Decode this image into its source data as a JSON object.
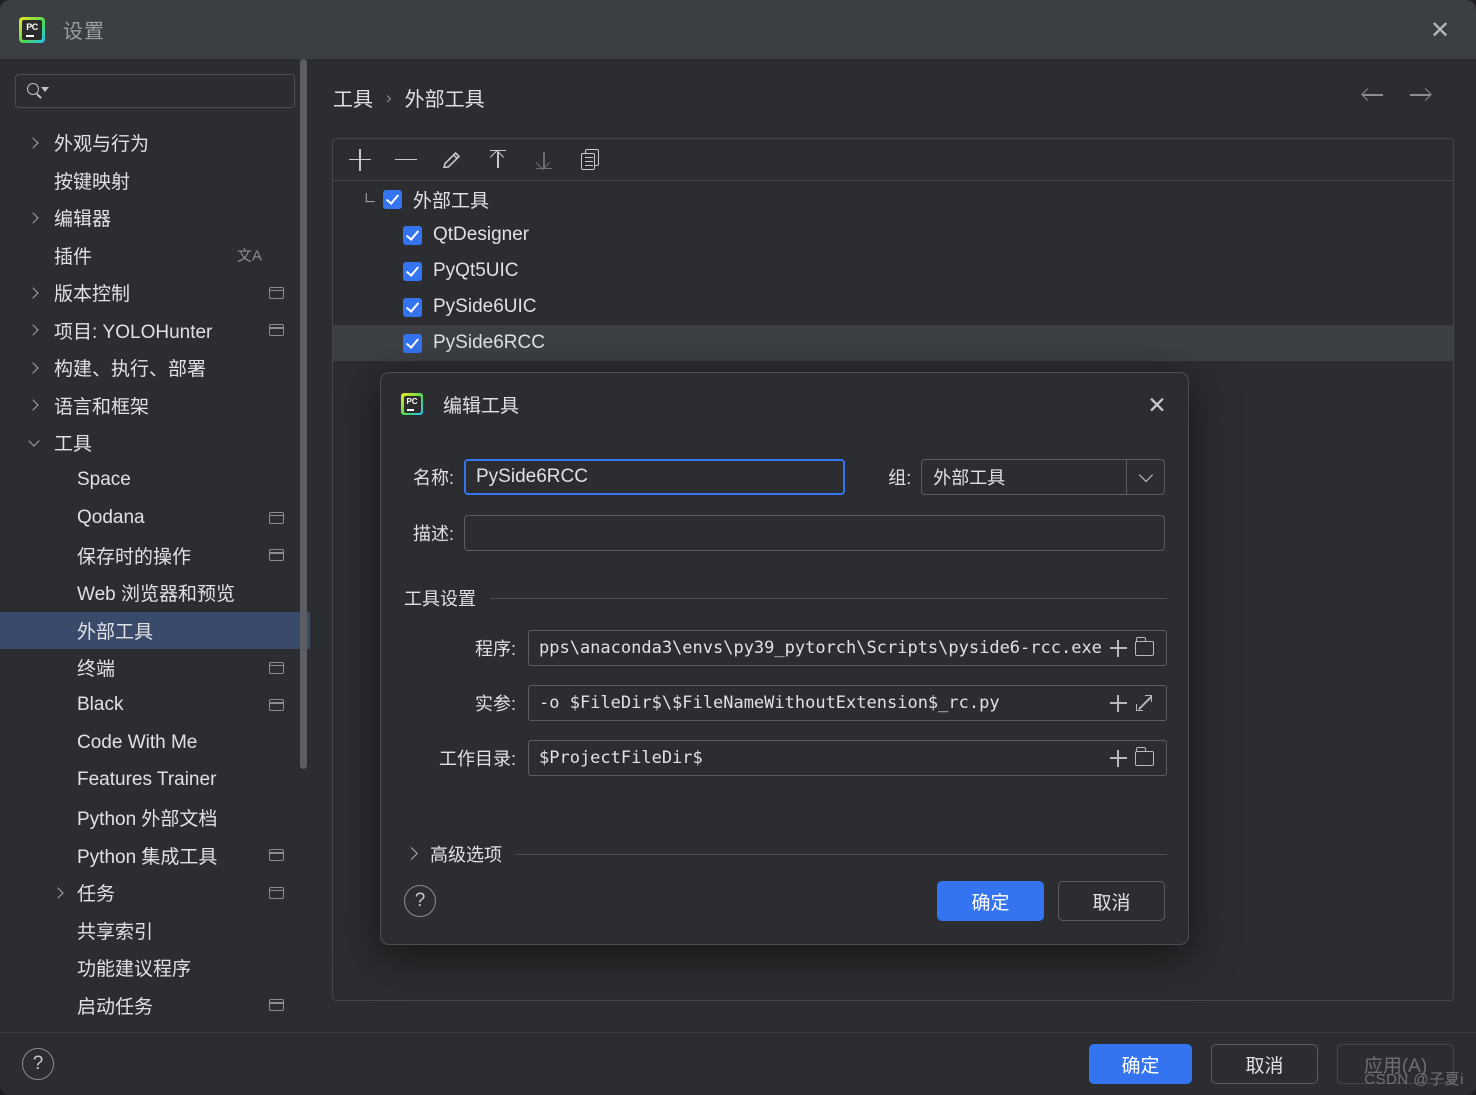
{
  "window": {
    "title": "设置",
    "app_icon": "pycharm-icon",
    "close_icon": "close-icon",
    "watermark": "CSDN @子夏i"
  },
  "sidebar": {
    "search": {
      "placeholder": "",
      "value": "",
      "icon": "search-icon"
    },
    "items": [
      {
        "label": "外观与行为",
        "arrow": "chevron-right",
        "indent": 0,
        "badge": null,
        "selected": false
      },
      {
        "label": "按键映射",
        "arrow": null,
        "indent": 0,
        "badge": null,
        "selected": false
      },
      {
        "label": "编辑器",
        "arrow": "chevron-right",
        "indent": 0,
        "badge": null,
        "selected": false
      },
      {
        "label": "插件",
        "arrow": null,
        "indent": 0,
        "badge": "translate",
        "selected": false
      },
      {
        "label": "版本控制",
        "arrow": "chevron-right",
        "indent": 0,
        "badge": "window",
        "selected": false
      },
      {
        "label": "项目: YOLOHunter",
        "arrow": "chevron-right",
        "indent": 0,
        "badge": "window",
        "selected": false
      },
      {
        "label": "构建、执行、部署",
        "arrow": "chevron-right",
        "indent": 0,
        "badge": null,
        "selected": false
      },
      {
        "label": "语言和框架",
        "arrow": "chevron-right",
        "indent": 0,
        "badge": null,
        "selected": false
      },
      {
        "label": "工具",
        "arrow": "chevron-down",
        "indent": 0,
        "badge": null,
        "selected": false
      },
      {
        "label": "Space",
        "arrow": null,
        "indent": 1,
        "badge": null,
        "selected": false
      },
      {
        "label": "Qodana",
        "arrow": null,
        "indent": 1,
        "badge": "window",
        "selected": false
      },
      {
        "label": "保存时的操作",
        "arrow": null,
        "indent": 1,
        "badge": "window",
        "selected": false
      },
      {
        "label": "Web 浏览器和预览",
        "arrow": null,
        "indent": 1,
        "badge": null,
        "selected": false
      },
      {
        "label": "外部工具",
        "arrow": null,
        "indent": 1,
        "badge": null,
        "selected": true
      },
      {
        "label": "终端",
        "arrow": null,
        "indent": 1,
        "badge": "window",
        "selected": false
      },
      {
        "label": "Black",
        "arrow": null,
        "indent": 1,
        "badge": "window",
        "selected": false
      },
      {
        "label": "Code With Me",
        "arrow": null,
        "indent": 1,
        "badge": null,
        "selected": false
      },
      {
        "label": "Features Trainer",
        "arrow": null,
        "indent": 1,
        "badge": null,
        "selected": false
      },
      {
        "label": "Python 外部文档",
        "arrow": null,
        "indent": 1,
        "badge": null,
        "selected": false
      },
      {
        "label": "Python 集成工具",
        "arrow": null,
        "indent": 1,
        "badge": "window",
        "selected": false
      },
      {
        "label": "任务",
        "arrow": "chevron-right",
        "indent": 1,
        "badge": "window",
        "selected": false
      },
      {
        "label": "共享索引",
        "arrow": null,
        "indent": 1,
        "badge": null,
        "selected": false
      },
      {
        "label": "功能建议程序",
        "arrow": null,
        "indent": 1,
        "badge": null,
        "selected": false
      },
      {
        "label": "启动任务",
        "arrow": null,
        "indent": 1,
        "badge": "window",
        "selected": false
      }
    ]
  },
  "main": {
    "breadcrumb": {
      "parent": "工具",
      "separator": "›",
      "current": "外部工具"
    },
    "nav": {
      "back_icon": "arrow-left-icon",
      "forward_icon": "arrow-right-icon"
    },
    "toolbar": [
      {
        "name": "add-button",
        "icon": "plus-icon",
        "disabled": false
      },
      {
        "name": "remove-button",
        "icon": "minus-icon",
        "disabled": false
      },
      {
        "name": "edit-button",
        "icon": "pencil-icon",
        "disabled": false
      },
      {
        "name": "move-up-button",
        "icon": "arrow-up-icon",
        "disabled": false
      },
      {
        "name": "move-down-button",
        "icon": "arrow-down-icon",
        "disabled": true
      },
      {
        "name": "copy-button",
        "icon": "copy-icon",
        "disabled": false
      }
    ],
    "tree": [
      {
        "label": "外部工具",
        "level": 0,
        "checked": true,
        "expanded": true,
        "selected": false
      },
      {
        "label": "QtDesigner",
        "level": 1,
        "checked": true,
        "expanded": null,
        "selected": false
      },
      {
        "label": "PyQt5UIC",
        "level": 1,
        "checked": true,
        "expanded": null,
        "selected": false
      },
      {
        "label": "PySide6UIC",
        "level": 1,
        "checked": true,
        "expanded": null,
        "selected": false
      },
      {
        "label": "PySide6RCC",
        "level": 1,
        "checked": true,
        "expanded": null,
        "selected": true
      }
    ]
  },
  "dialog": {
    "title": "编辑工具",
    "close_icon": "close-icon",
    "name_label": "名称:",
    "name_value": "PySide6RCC",
    "group_label": "组:",
    "group_value": "外部工具",
    "desc_label": "描述:",
    "desc_value": "",
    "settings_group_title": "工具设置",
    "program_label": "程序:",
    "program_value": "pps\\anaconda3\\envs\\py39_pytorch\\Scripts\\pyside6-rcc.exe",
    "arguments_label": "实参:",
    "arguments_value": " -o $FileDir$\\$FileNameWithoutExtension$_rc.py",
    "workdir_label": "工作目录:",
    "workdir_value": "$ProjectFileDir$",
    "advanced_label": "高级选项",
    "help_icon": "help-icon",
    "ok_label": "确定",
    "cancel_label": "取消"
  },
  "footer": {
    "help_icon": "help-icon",
    "ok_label": "确定",
    "cancel_label": "取消",
    "apply_label": "应用(A)"
  },
  "colors": {
    "accent": "#3574f0",
    "background": "#2b2d30",
    "titlebar": "#3c3f41",
    "selection": "#3a4a6b",
    "row_selection": "#3d4043",
    "text": "#dfe1e5",
    "muted": "#8a8d91"
  }
}
